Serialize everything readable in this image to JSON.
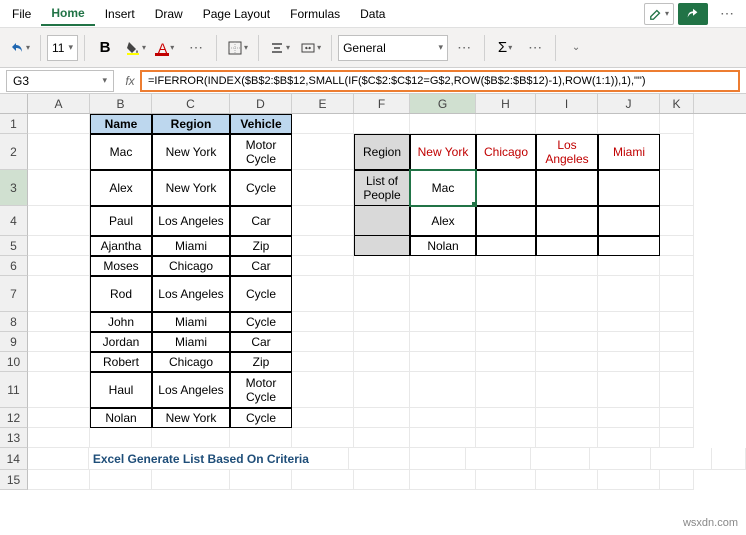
{
  "menu": {
    "file": "File",
    "home": "Home",
    "insert": "Insert",
    "draw": "Draw",
    "pagelayout": "Page Layout",
    "formulas": "Formulas",
    "data": "Data"
  },
  "ribbon": {
    "font_size": "11",
    "number_format": "General"
  },
  "namebox": "G3",
  "formula": "=IFERROR(INDEX($B$2:$B$12,SMALL(IF($C$2:$C$12=G$2,ROW($B$2:$B$12)-1),ROW(1:1)),1),\"\")",
  "cols": [
    "A",
    "B",
    "C",
    "D",
    "E",
    "F",
    "G",
    "H",
    "I",
    "J",
    "K"
  ],
  "table1": {
    "headers": [
      "Name",
      "Region",
      "Vehicle"
    ],
    "rows": [
      [
        "Mac",
        "New York",
        "Motor Cycle"
      ],
      [
        "Alex",
        "New York",
        "Cycle"
      ],
      [
        "Paul",
        "Los Angeles",
        "Car"
      ],
      [
        "Ajantha",
        "Miami",
        "Zip"
      ],
      [
        "Moses",
        "Chicago",
        "Car"
      ],
      [
        "Rod",
        "Los Angeles",
        "Cycle"
      ],
      [
        "John",
        "Miami",
        "Cycle"
      ],
      [
        "Jordan",
        "Miami",
        "Car"
      ],
      [
        "Robert",
        "Chicago",
        "Zip"
      ],
      [
        "Haul",
        "Los Angeles",
        "Motor Cycle"
      ],
      [
        "Nolan",
        "New York",
        "Cycle"
      ]
    ]
  },
  "table2": {
    "row_headers": [
      "Region",
      "List of People"
    ],
    "col_headers": [
      "New York",
      "Chicago",
      "Los Angeles",
      "Miami"
    ],
    "results": [
      "Mac",
      "Alex",
      "Nolan"
    ]
  },
  "note": "Excel Generate List Based On Criteria",
  "watermark": "wsxdn.com"
}
